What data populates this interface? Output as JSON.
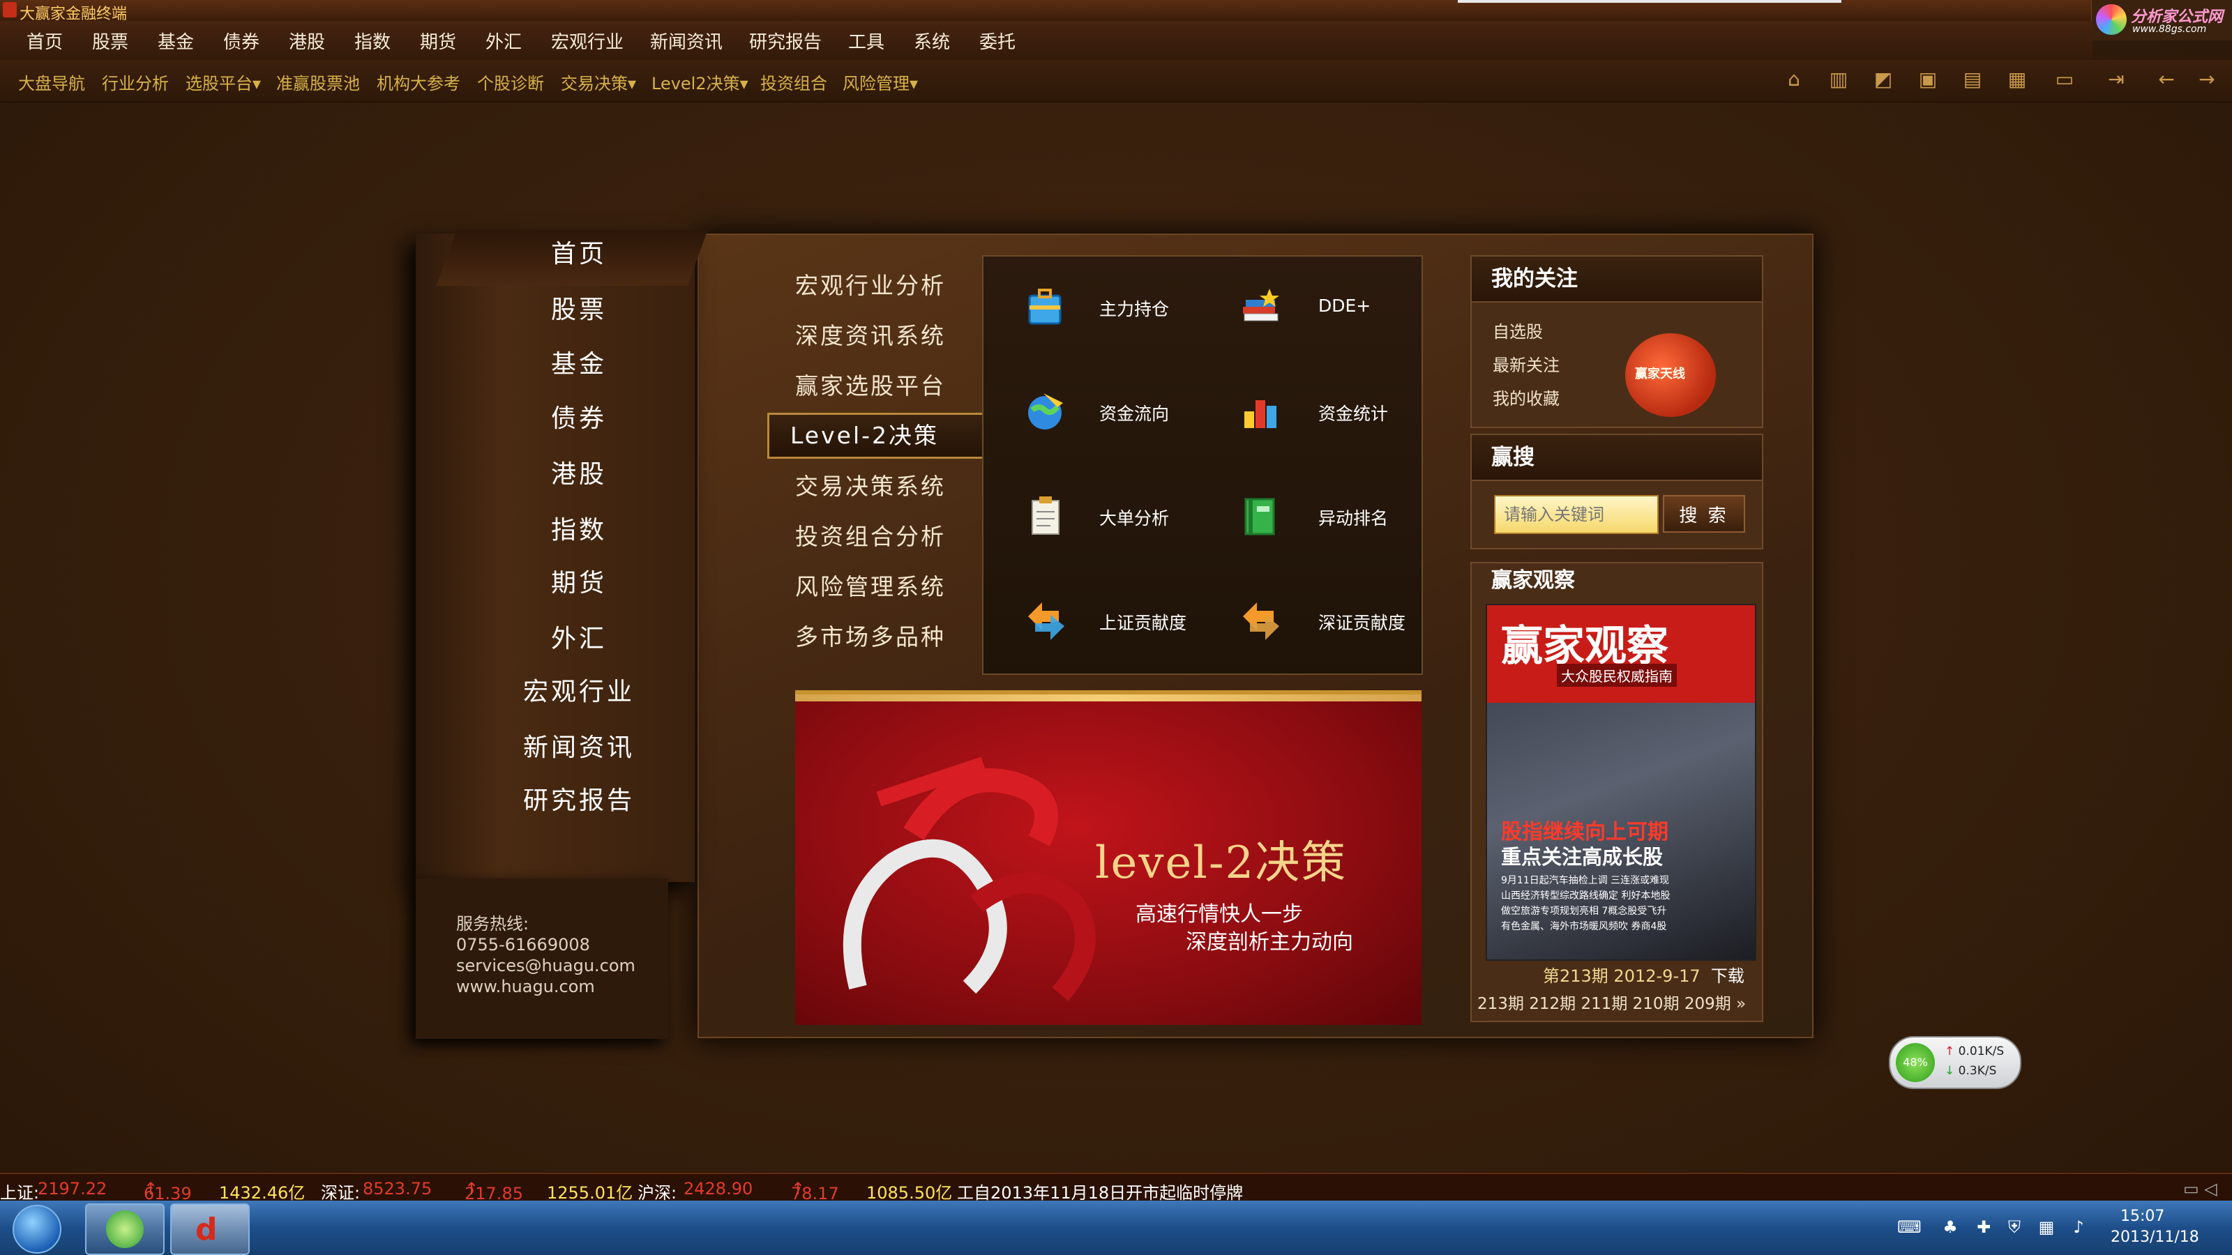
{
  "window": {
    "title": "大赢家金融终端"
  },
  "corner_logo": {
    "line1": "分析家公式网",
    "line2": "www.88gs.com"
  },
  "main_menu": [
    "首页",
    "股票",
    "基金",
    "债券",
    "港股",
    "指数",
    "期货",
    "外汇",
    "宏观行业",
    "新闻资讯",
    "研究报告",
    "工具",
    "系统",
    "委托"
  ],
  "toolbar": {
    "items": [
      "大盘导航",
      "行业分析",
      "选股平台",
      "准赢股票池",
      "机构大参考",
      "个股诊断",
      "交易决策",
      "Level2决策",
      "投资组合",
      "风险管理"
    ],
    "dropdown_items": [
      "选股平台",
      "交易决策",
      "Level2决策",
      "风险管理"
    ],
    "tool_icons": [
      "home-icon",
      "building-icon",
      "chart-icon",
      "calculator-icon",
      "f8-icon",
      "f10-icon",
      "monitor-icon",
      "exit-icon",
      "back-icon",
      "forward-icon"
    ]
  },
  "left_nav": [
    "首页",
    "股票",
    "基金",
    "债券",
    "港股",
    "指数",
    "期货",
    "外汇",
    "宏观行业",
    "新闻资讯",
    "研究报告"
  ],
  "left_nav_active": "首页",
  "contact": {
    "label": "服务热线:",
    "phone": "0755-61669008",
    "email": "services@huagu.com",
    "site": "www.huagu.com"
  },
  "sub_nav": [
    "宏观行业分析",
    "深度资讯系统",
    "赢家选股平台",
    "Level-2决策",
    "交易决策系统",
    "投资组合分析",
    "风险管理系统",
    "多市场多品种"
  ],
  "sub_nav_active": "Level-2决策",
  "features": [
    {
      "label": "主力持仓",
      "icon": "briefcase-icon"
    },
    {
      "label": "DDE+",
      "icon": "books-icon"
    },
    {
      "label": "资金流向",
      "icon": "globe-icon"
    },
    {
      "label": "资金统计",
      "icon": "bar-chart-icon"
    },
    {
      "label": "大单分析",
      "icon": "clipboard-icon"
    },
    {
      "label": "异动排名",
      "icon": "green-book-icon"
    },
    {
      "label": "上证贡献度",
      "icon": "arrows-icon"
    },
    {
      "label": "深证贡献度",
      "icon": "arrows-icon"
    }
  ],
  "banner": {
    "title": "level-2决策",
    "line1": "高速行情快人一步",
    "line2": "深度剖析主力动向"
  },
  "my_watch": {
    "title": "我的关注",
    "links": [
      "自选股",
      "最新关注",
      "我的收藏"
    ],
    "tv_label": "赢家天线"
  },
  "search": {
    "title": "赢搜",
    "placeholder": "请输入关键词",
    "button": "搜 索"
  },
  "observe": {
    "title": "赢家观察",
    "cover_title": "赢家观察",
    "cover_subtitle": "大众股民权威指南",
    "headline1": "股指继续向上可期",
    "headline2": "重点关注高成长股",
    "cover_lines": [
      "9月11日起汽车抽检上调 三连涨或难现",
      "山西经济转型综改路线确定 利好本地股",
      "做空旅游专项规划亮相 7概念股受飞升",
      "有色金属、海外市场暖风频吹 券商4股"
    ],
    "issue": "第213期  2012-9-17",
    "download": "下载",
    "issues": [
      "213期",
      "212期",
      "211期",
      "210期",
      "209期"
    ],
    "more": "»"
  },
  "net_widget": {
    "percent": "48%",
    "up": "0.01K/S",
    "down": "0.3K/S"
  },
  "status": {
    "sh_label": "上证:",
    "sh_value": "2197.22",
    "sh_change": "61.39",
    "sh_amount": "1432.46亿",
    "sz_label": "深证:",
    "sz_value": "8523.75",
    "sz_change": "217.85",
    "sz_amount": "1255.01亿",
    "hs_label": "沪深:",
    "hs_value": "2428.90",
    "hs_change": "78.17",
    "hs_amount": "1085.50亿",
    "notice": "工自2013年11月18日开市起临时停牌"
  },
  "taskbar": {
    "time": "15:07",
    "date": "2013/11/18"
  },
  "colors": {
    "menu_text": "#f5ecd8",
    "toolbar_text": "#d7b24a",
    "status_red": "#e23b2a",
    "status_yellow": "#ffe55a",
    "accent_gold": "#b8883c"
  }
}
